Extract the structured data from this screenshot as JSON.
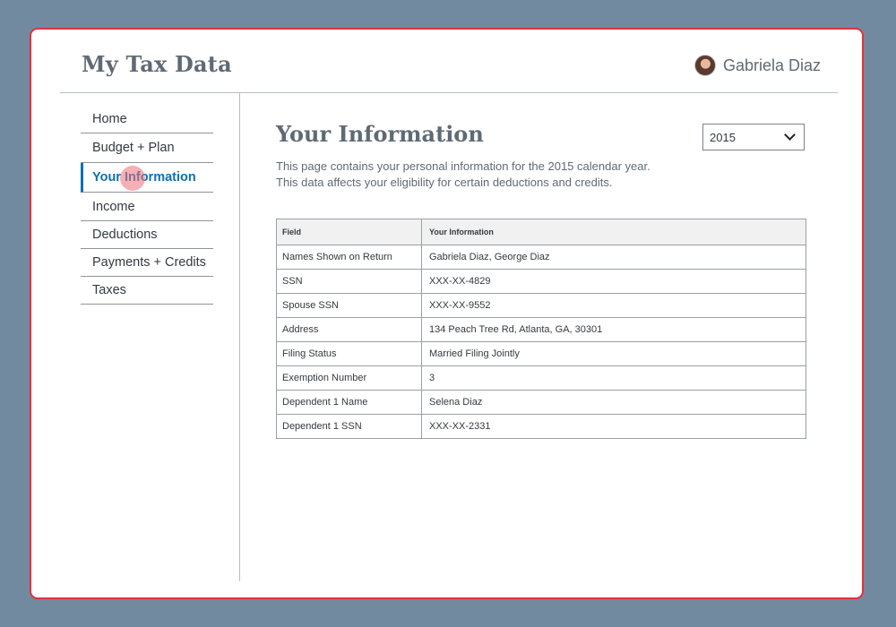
{
  "app": {
    "title": "My Tax Data"
  },
  "user": {
    "name": "Gabriela Diaz",
    "avatar_icon": "user-avatar"
  },
  "sidebar": {
    "items": [
      {
        "label": "Home",
        "active": false
      },
      {
        "label": "Budget + Plan",
        "active": false
      },
      {
        "label": "Your Information",
        "active": true
      },
      {
        "label": "Income",
        "active": false
      },
      {
        "label": "Deductions",
        "active": false
      },
      {
        "label": "Payments + Credits",
        "active": false
      },
      {
        "label": "Taxes",
        "active": false
      }
    ]
  },
  "main": {
    "title": "Your Information",
    "year_select": {
      "value": "2015",
      "icon": "chevron-down-icon"
    },
    "intro_lines": [
      "This page contains your personal information for the 2015 calendar year.",
      "This data affects your eligibility for certain deductions and credits."
    ],
    "table": {
      "headers": [
        "Field",
        "Your Information"
      ],
      "rows": [
        [
          "Names Shown on Return",
          "Gabriela Diaz, George Diaz"
        ],
        [
          "SSN",
          "XXX-XX-4829"
        ],
        [
          "Spouse SSN",
          "XXX-XX-9552"
        ],
        [
          "Address",
          "134 Peach Tree Rd, Atlanta, GA, 30301"
        ],
        [
          "Filing Status",
          "Married Filing Jointly"
        ],
        [
          "Exemption Number",
          "3"
        ],
        [
          "Dependent 1 Name",
          "Selena Diaz"
        ],
        [
          "Dependent 1 SSN",
          "XXX-XX-2331"
        ]
      ]
    }
  },
  "colors": {
    "background": "#718a9f",
    "window_border": "#e0313f",
    "accent": "#0c71b4",
    "heading": "#5f6a75"
  }
}
